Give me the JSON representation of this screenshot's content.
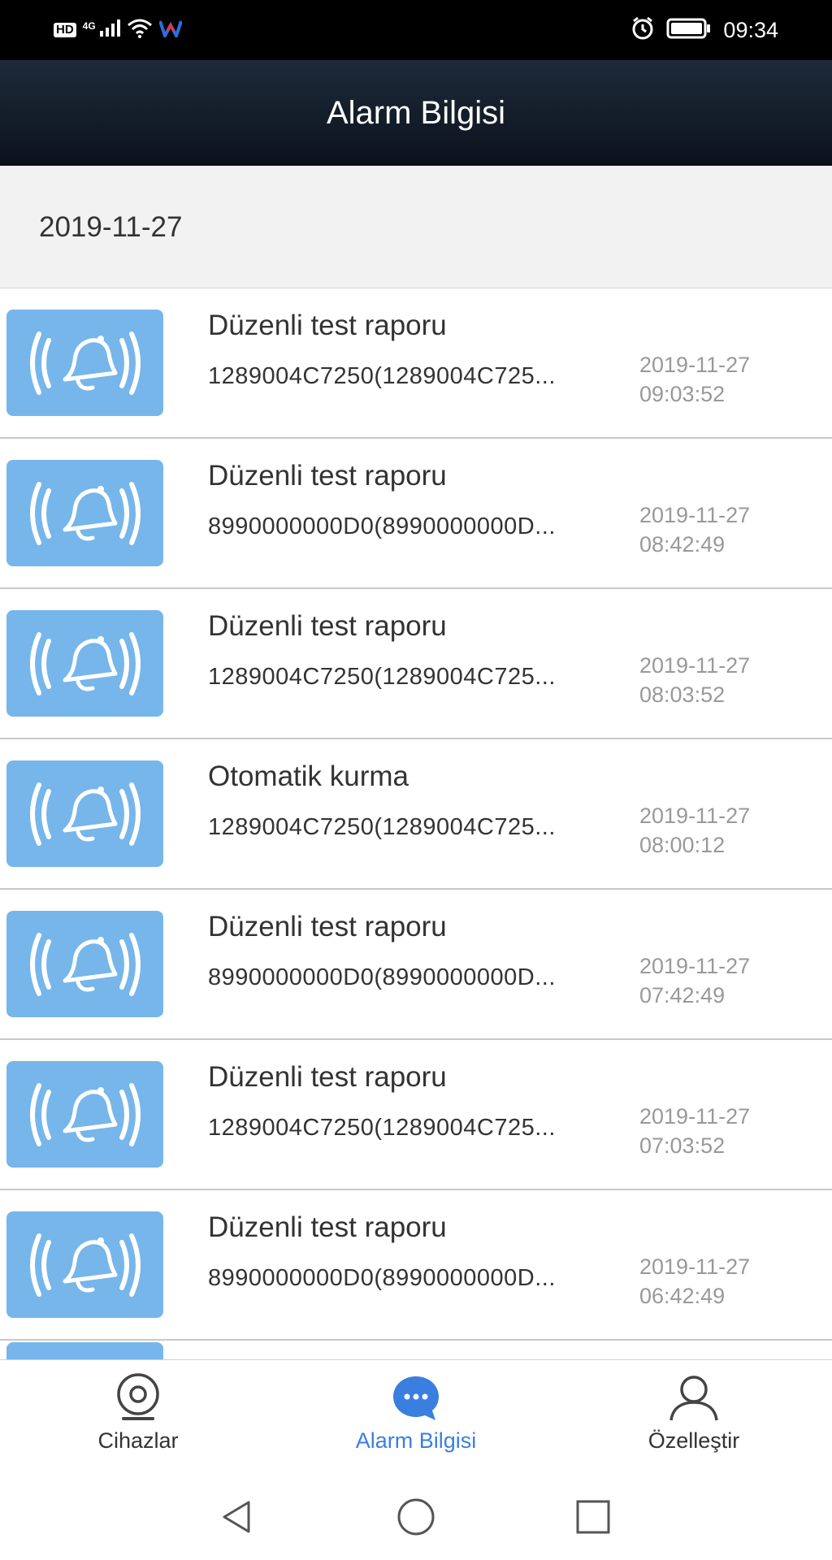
{
  "status_bar": {
    "hd_badge": "HD",
    "network": "4G",
    "time": "09:34",
    "icons": [
      "signal-icon",
      "wifi-icon",
      "app-w-icon",
      "alarm-clock-icon",
      "battery-icon"
    ]
  },
  "header": {
    "title": "Alarm Bilgisi"
  },
  "date_header": "2019-11-27",
  "alarms": [
    {
      "title": "Düzenli test raporu",
      "device": "1289004C7250(1289004C725...",
      "date": "2019-11-27",
      "time": "09:03:52"
    },
    {
      "title": "Düzenli test raporu",
      "device": "8990000000D0(8990000000D...",
      "date": "2019-11-27",
      "time": "08:42:49"
    },
    {
      "title": "Düzenli test raporu",
      "device": "1289004C7250(1289004C725...",
      "date": "2019-11-27",
      "time": "08:03:52"
    },
    {
      "title": "Otomatik kurma",
      "device": "1289004C7250(1289004C725...",
      "date": "2019-11-27",
      "time": "08:00:12"
    },
    {
      "title": "Düzenli test raporu",
      "device": "8990000000D0(8990000000D...",
      "date": "2019-11-27",
      "time": "07:42:49"
    },
    {
      "title": "Düzenli test raporu",
      "device": "1289004C7250(1289004C725...",
      "date": "2019-11-27",
      "time": "07:03:52"
    },
    {
      "title": "Düzenli test raporu",
      "device": "8990000000D0(8990000000D...",
      "date": "2019-11-27",
      "time": "06:42:49"
    }
  ],
  "tabs": [
    {
      "label": "Cihazlar",
      "icon": "camera-icon"
    },
    {
      "label": "Alarm Bilgisi",
      "icon": "chat-bubble-icon"
    },
    {
      "label": "Özelleştir",
      "icon": "person-icon"
    }
  ],
  "colors": {
    "accent": "#3a7fe0",
    "icon_tile": "#76b6ea",
    "header_bg": "#0b121c"
  }
}
